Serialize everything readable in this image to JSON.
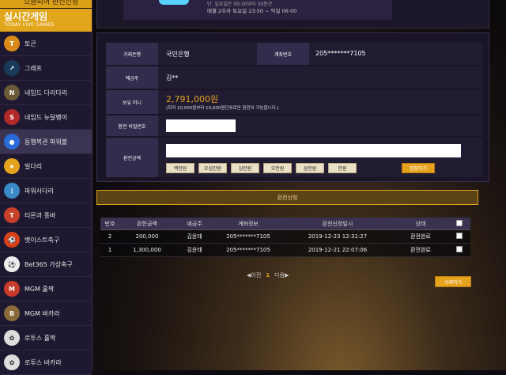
{
  "sidebar": {
    "top_fragment": "으뜸되어 환전신청",
    "section_title": "실시간게임",
    "section_subtitle": "TODAY LIVE GAMES",
    "items": [
      {
        "label": "토큰",
        "icon": "token-icon",
        "color": "#d98a1a",
        "glyph": "T"
      },
      {
        "label": "그래프",
        "icon": "graph-icon",
        "color": "#1a3a5a",
        "glyph": "↗"
      },
      {
        "label": "네임드 다리다리",
        "icon": "named-ladder-icon",
        "color": "#6a5a3a",
        "glyph": "N"
      },
      {
        "label": "네임드 뉴달팽이",
        "icon": "snail-icon",
        "color": "#b32828",
        "glyph": "S"
      },
      {
        "label": "동행복권 파워볼",
        "icon": "powerball-icon",
        "color": "#2a6ad8",
        "glyph": "●"
      },
      {
        "label": "빌다리",
        "icon": "star-icon",
        "color": "#e5a21c",
        "glyph": "★"
      },
      {
        "label": "파워사다리",
        "icon": "power-ladder-icon",
        "color": "#3a8ac8",
        "glyph": "⋮"
      },
      {
        "label": "티몬과 퐁바",
        "icon": "timon-icon",
        "color": "#c8402a",
        "glyph": "T"
      },
      {
        "label": "벳이스트축구",
        "icon": "soccer-icon",
        "color": "#d8401a",
        "glyph": "⚽"
      },
      {
        "label": "Bet365 가상축구",
        "icon": "bet365-soccer-icon",
        "color": "#eeeeee",
        "glyph": "⚽"
      },
      {
        "label": "MGM 홀짝",
        "icon": "mgm-oddeven-icon",
        "color": "#c83a2a",
        "glyph": "M"
      },
      {
        "label": "MGM 바카라",
        "icon": "mgm-baccarat-icon",
        "color": "#8a6a3a",
        "glyph": "B"
      },
      {
        "label": "로투스 홀짝",
        "icon": "lotus-oddeven-icon",
        "color": "#dddddd",
        "glyph": "✿"
      },
      {
        "label": "로투스 바카라",
        "icon": "lotus-baccarat-icon",
        "color": "#dddddd",
        "glyph": "✿"
      }
    ]
  },
  "top_card": {
    "line1": "단, 일요일은 00:30부터 30분간",
    "line2": "매월 2주차 토요일 23:50 ~ 익일 06:00"
  },
  "form": {
    "bank_label": "거래은행",
    "bank_value": "국민은행",
    "account_label": "계좌번호",
    "account_value": "205*******7105",
    "holder_label": "예금주",
    "holder_value": "김**",
    "money_label": "보유 머니",
    "money_value": "2,791,000원",
    "money_note": "(최저 10,000원부터 10,000원단위로만 환전이 가능합니다.)",
    "password_label": "환전 비밀번호",
    "password_value": "",
    "amount_label": "환전금액",
    "amount_value": "",
    "amount_buttons": [
      "백만원",
      "오십만원",
      "십만원",
      "오만원",
      "삼만원",
      "만원"
    ],
    "reset_label": "정정하기"
  },
  "submit_label": "환전신청",
  "table": {
    "headers": [
      "번호",
      "환전금액",
      "예금주",
      "계좌정보",
      "환전신청일시",
      "상태"
    ],
    "rows": [
      {
        "no": "2",
        "amount": "200,000",
        "holder": "김윤태",
        "account": "205*******7105",
        "date": "2019-12-23 12:31:27",
        "status": "환전완료"
      },
      {
        "no": "1",
        "amount": "1,300,000",
        "holder": "김윤태",
        "account": "205*******7105",
        "date": "2019-12-21 22:07:06",
        "status": "환전완료"
      }
    ]
  },
  "pager": {
    "prev": "◀이전",
    "current": "1",
    "next": "다음▶"
  },
  "delete_label": "삭제하기",
  "colors": {
    "accent": "#e5a21c",
    "sidebar_bg": "#1e1830",
    "label_bg": "#342c4c"
  }
}
